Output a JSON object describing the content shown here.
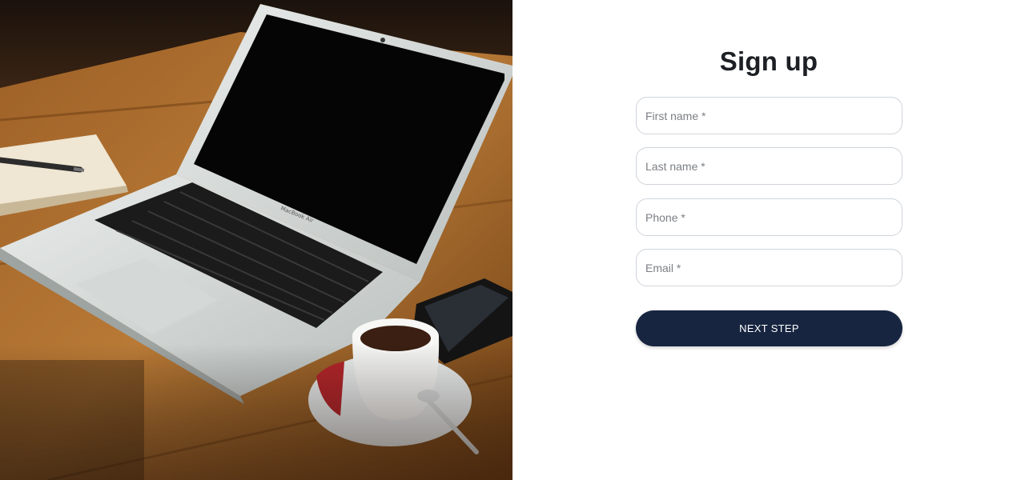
{
  "hero": {
    "image_name": "laptop-coffee-desk-photo",
    "laptop_label": "MacBook Air"
  },
  "form": {
    "title": "Sign up",
    "fields": [
      {
        "placeholder": "First name *",
        "value": ""
      },
      {
        "placeholder": "Last name *",
        "value": ""
      },
      {
        "placeholder": "Phone *",
        "value": ""
      },
      {
        "placeholder": "Email *",
        "value": ""
      }
    ],
    "submit_label": "NEXT STEP"
  },
  "colors": {
    "button_bg": "#172540",
    "button_text": "#ffffff",
    "title": "#1c1f24",
    "field_border": "#cfd4da",
    "placeholder": "#7b7f84"
  }
}
